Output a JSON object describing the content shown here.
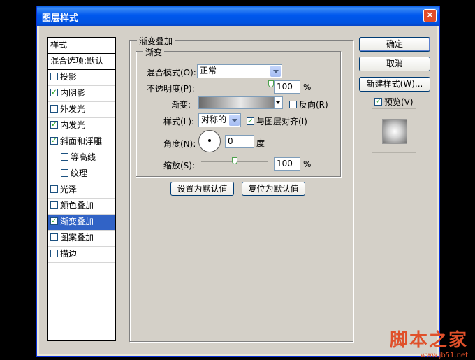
{
  "window": {
    "title": "图层样式"
  },
  "styles_panel": {
    "header": "样式",
    "blend_options": "混合选项:默认",
    "items": [
      {
        "label": "投影",
        "checked": false,
        "sub": false,
        "selected": false
      },
      {
        "label": "内阴影",
        "checked": true,
        "sub": false,
        "selected": false
      },
      {
        "label": "外发光",
        "checked": false,
        "sub": false,
        "selected": false
      },
      {
        "label": "内发光",
        "checked": true,
        "sub": false,
        "selected": false
      },
      {
        "label": "斜面和浮雕",
        "checked": true,
        "sub": false,
        "selected": false
      },
      {
        "label": "等高线",
        "checked": false,
        "sub": true,
        "selected": false
      },
      {
        "label": "纹理",
        "checked": false,
        "sub": true,
        "selected": false
      },
      {
        "label": "光泽",
        "checked": false,
        "sub": false,
        "selected": false
      },
      {
        "label": "颜色叠加",
        "checked": false,
        "sub": false,
        "selected": false
      },
      {
        "label": "渐变叠加",
        "checked": true,
        "sub": false,
        "selected": true
      },
      {
        "label": "图案叠加",
        "checked": false,
        "sub": false,
        "selected": false
      },
      {
        "label": "描边",
        "checked": false,
        "sub": false,
        "selected": false
      }
    ]
  },
  "gradient_overlay": {
    "group_title": "渐变叠加",
    "subgroup_title": "渐变",
    "blend_mode_label": "混合模式(O):",
    "blend_mode_value": "正常",
    "opacity_label": "不透明度(P):",
    "opacity_value": "100",
    "opacity_pct": 1.0,
    "percent": "%",
    "gradient_label": "渐变:",
    "reverse_label": "反向(R)",
    "reverse_checked": false,
    "style_label": "样式(L):",
    "style_value": "对称的",
    "align_label": "与图层对齐(I)",
    "align_checked": true,
    "angle_label": "角度(N):",
    "angle_value": "0",
    "degree": "度",
    "scale_label": "缩放(S):",
    "scale_value": "100",
    "scale_pct": 0.5,
    "make_default": "设置为默认值",
    "reset_default": "复位为默认值"
  },
  "buttons": {
    "ok": "确定",
    "cancel": "取消",
    "new_style": "新建样式(W)...",
    "preview_label": "预览(V)",
    "preview_checked": true
  },
  "watermark": {
    "text": "脚本之家",
    "url": "www.jb51.net"
  }
}
